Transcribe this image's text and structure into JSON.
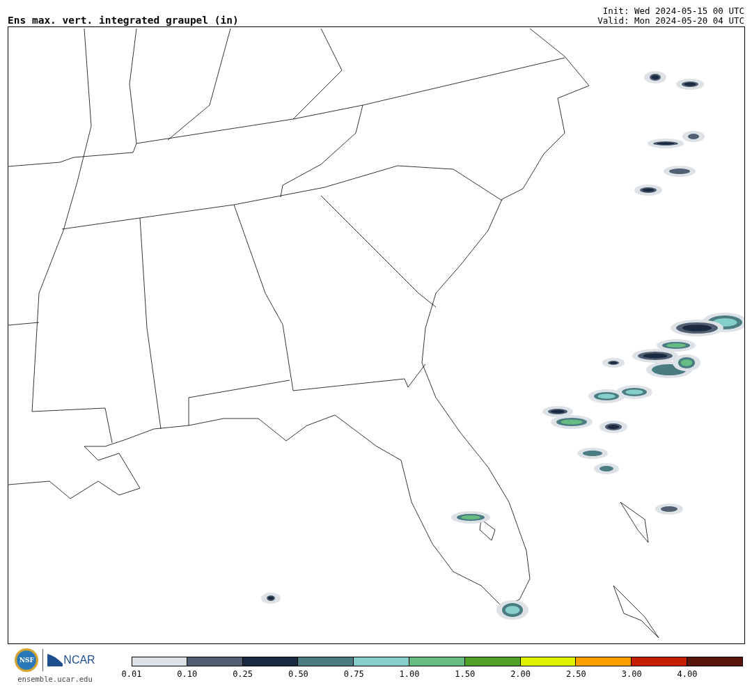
{
  "title": "Ens max. vert. integrated graupel (in)",
  "init": "Init: Wed 2024-05-15 00 UTC",
  "valid": "Valid: Mon 2024-05-20 04 UTC",
  "logos": {
    "nsf": "NSF",
    "ncar": "NCAR"
  },
  "site": "ensemble.ucar.edu",
  "legend": [
    {
      "label": "0.01",
      "color": "#dde2e7"
    },
    {
      "label": "0.10",
      "color": "#525e71"
    },
    {
      "label": "0.25",
      "color": "#1b2a40"
    },
    {
      "label": "0.50",
      "color": "#4a7c82"
    },
    {
      "label": "0.75",
      "color": "#85cec9"
    },
    {
      "label": "1.00",
      "color": "#66bc82"
    },
    {
      "label": "1.50",
      "color": "#51a327"
    },
    {
      "label": "2.00",
      "color": "#dff200"
    },
    {
      "label": "2.50",
      "color": "#fd9f00"
    },
    {
      "label": "3.00",
      "color": "#c22000"
    },
    {
      "label": "4.00",
      "color": "#5a150b"
    }
  ]
}
